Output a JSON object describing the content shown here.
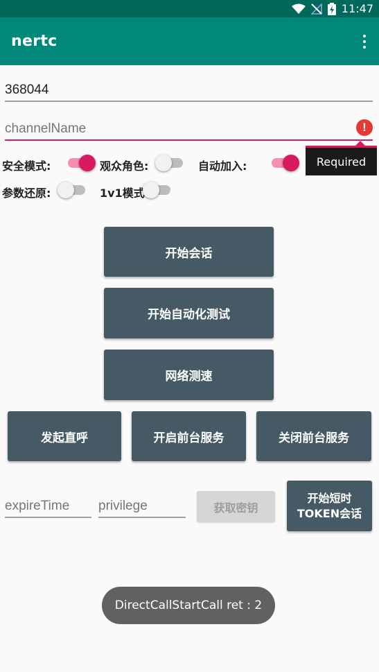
{
  "status_bar": {
    "time": "11:47",
    "icons": [
      "wifi-icon",
      "no-signal-icon",
      "battery-charging-icon"
    ]
  },
  "app_bar": {
    "title": "nertc",
    "menu_icon": "more-vert-icon"
  },
  "form": {
    "room_value": "368044",
    "channel_placeholder": "channelName",
    "channel_error_icon": "error-icon",
    "channel_error_text": "Required"
  },
  "switches": [
    {
      "label": "安全模式:",
      "on": true
    },
    {
      "label": "观众角色:",
      "on": false
    },
    {
      "label": "自动加入:",
      "on": true
    },
    {
      "label": "参数还原:",
      "on": false
    },
    {
      "label": "1v1模式",
      "on": false
    }
  ],
  "buttons": {
    "start_call": "开始会话",
    "start_auto_test": "开始自动化测试",
    "network_speed": "网络测速",
    "direct_call": "发起直呼",
    "start_foreground": "开启前台服务",
    "stop_foreground": "关闭前台服务",
    "get_key": "获取密钥",
    "start_short_token_line1": "开始短时",
    "start_short_token_line2": "TOKEN会话"
  },
  "token_form": {
    "expire_placeholder": "expireTime",
    "privilege_placeholder": "privilege"
  },
  "toast": {
    "text": "DirectCallStartCall ret : 2"
  },
  "colors": {
    "status_bar": "#00695c",
    "app_bar": "#00897b",
    "accent": "#d81b60",
    "button": "#455a64"
  }
}
